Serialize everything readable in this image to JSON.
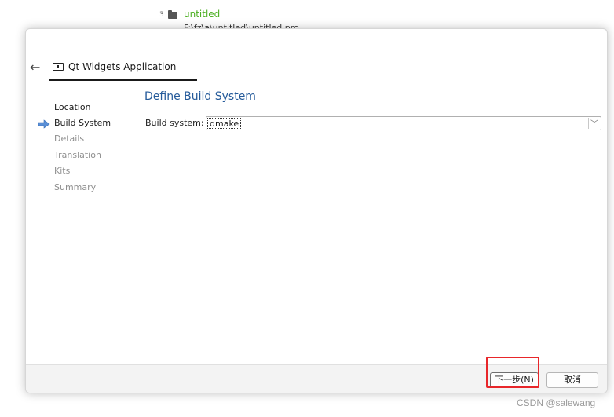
{
  "background_project": {
    "index": "3",
    "name": "untitled",
    "path": "F:\\fz\\a\\untitled\\untitled.pro"
  },
  "dialog": {
    "back_icon": "back-arrow-icon",
    "title_icon": "qt-widgets-icon",
    "title": "Qt Widgets Application",
    "steps": [
      {
        "label": "Location",
        "state": "done"
      },
      {
        "label": "Build System",
        "state": "current"
      },
      {
        "label": "Details",
        "state": "todo"
      },
      {
        "label": "Translation",
        "state": "todo"
      },
      {
        "label": "Kits",
        "state": "todo"
      },
      {
        "label": "Summary",
        "state": "todo"
      }
    ],
    "page_title": "Define Build System",
    "build_system": {
      "label": "Build system:",
      "value": "qmake"
    },
    "buttons": {
      "next": "下一步(N)",
      "cancel": "取消"
    }
  },
  "colors": {
    "accent": "#245a9a",
    "project_green": "#4caf22",
    "highlight": "#e8262a"
  },
  "watermark": "CSDN @salewang"
}
